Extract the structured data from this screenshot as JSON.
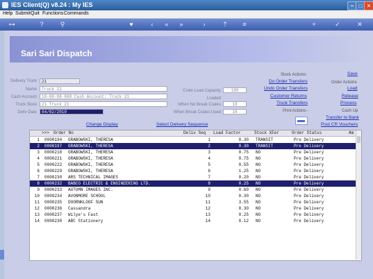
{
  "window": {
    "title": "IES Client(Q) v8.24 : My IES"
  },
  "menu": [
    "Help",
    "Submit",
    "Quit",
    "Functions",
    "Commands"
  ],
  "banner_title": "Sari Sari Dispatch",
  "form": {
    "delivery_truck": {
      "label": "Delivery Truck",
      "value": "21"
    },
    "name": {
      "label": "Name",
      "value": "Truck 21"
    },
    "cash_account": {
      "label": "Cash Account",
      "value": "18-88-88-868 Cash Account: Truck 21"
    },
    "truck_store": {
      "label": "Truck Store",
      "value": "21 Truck 21"
    },
    "deliv_date": {
      "label": "Deliv Date",
      "value": "04/02/2010"
    },
    "crate_load_capacity": {
      "label": "Crate Load Capacity",
      "value": "180"
    },
    "loaded": {
      "label": "Loaded",
      "value": ""
    },
    "when_no_break_crates": {
      "label": "When No Break Crates",
      "value": "18"
    },
    "when_break_crates_used": {
      "label": "When Break Crates Used",
      "value": "18"
    }
  },
  "actions": {
    "stock_label": "Stock Actions",
    "do_order_transfers": "Do Order Transfers",
    "undo_order_transfers": "Undo Order Transfers",
    "customer_returns": "Customer Returns",
    "truck_transfers": "Truck Transfers",
    "print_label": "Print Actions",
    "save": "Save",
    "order_label": "Order Actions",
    "load": "Load",
    "release": "Release",
    "process": "Process",
    "cashup_label": "Cash Up",
    "transfer_to_bank": "Transfer to Bank",
    "post_cr_vouchers": "Post CR Vouchers"
  },
  "grid_links": {
    "change_display": "Change Display",
    "select_delivery_sequence": "Select Delivery Sequence"
  },
  "grid": {
    "headers": [
      ">>>",
      "Order No",
      "Deliv Seq",
      "Load Factor",
      "Stock XFer",
      "Order Status",
      "Am"
    ],
    "rows": [
      [
        "1",
        "0000194",
        "GRABOWSKI, THERESA",
        "1",
        "0.30",
        "TRANSIT",
        "Pre Delivery"
      ],
      [
        "2",
        "0000197",
        "GRABOWSKI, THERESA",
        "2",
        "0.30",
        "TRANSIT",
        "Pre Delivery"
      ],
      [
        "3",
        "0000218",
        "GRABOWSKI, THERESA",
        "3",
        "0.75",
        "NO",
        "Pre Delivery"
      ],
      [
        "4",
        "0000221",
        "GRABOWSKI, THERESA",
        "4",
        "0.75",
        "NO",
        "Pre Delivery"
      ],
      [
        "5",
        "0000222",
        "GRABOWSKI, THERESA",
        "5",
        "0.55",
        "NO",
        "Pre Delivery"
      ],
      [
        "6",
        "0000229",
        "GRABOWSKI, THERESA",
        "6",
        "1.25",
        "NO",
        "Pre Delivery"
      ],
      [
        "7",
        "0000230",
        "ARS TECHNICAL IMAGES",
        "7",
        "0.20",
        "NO",
        "Pre Delivery"
      ],
      [
        "8",
        "0000232",
        "BABCO ELECTRIC & ENGINEERING LTD.",
        "8",
        "0.25",
        "NO",
        "Pre Delivery"
      ],
      [
        "9",
        "0000233",
        "AUTUMN IMAGES INC.",
        "9",
        "0.60",
        "NO",
        "Pre Delivery"
      ],
      [
        "10",
        "0000234",
        "AVONMORE SCHOOL",
        "10",
        "0.30",
        "NO",
        "Pre Delivery"
      ],
      [
        "11",
        "0000235",
        "DOORNKLOOF SUN",
        "11",
        "3.55",
        "NO",
        "Pre Delivery"
      ],
      [
        "12",
        "0000236",
        "Cassandra",
        "12",
        "0.30",
        "NO",
        "Pre Delivery"
      ],
      [
        "13",
        "0000237",
        "Wilye's Fast",
        "13",
        "0.25",
        "NO",
        "Pre Delivery"
      ],
      [
        "14",
        "0000238",
        "ABC Stationery",
        "14",
        "0.12",
        "NO",
        "Pre Delivery"
      ]
    ],
    "selected_rows": [
      2,
      8
    ]
  }
}
